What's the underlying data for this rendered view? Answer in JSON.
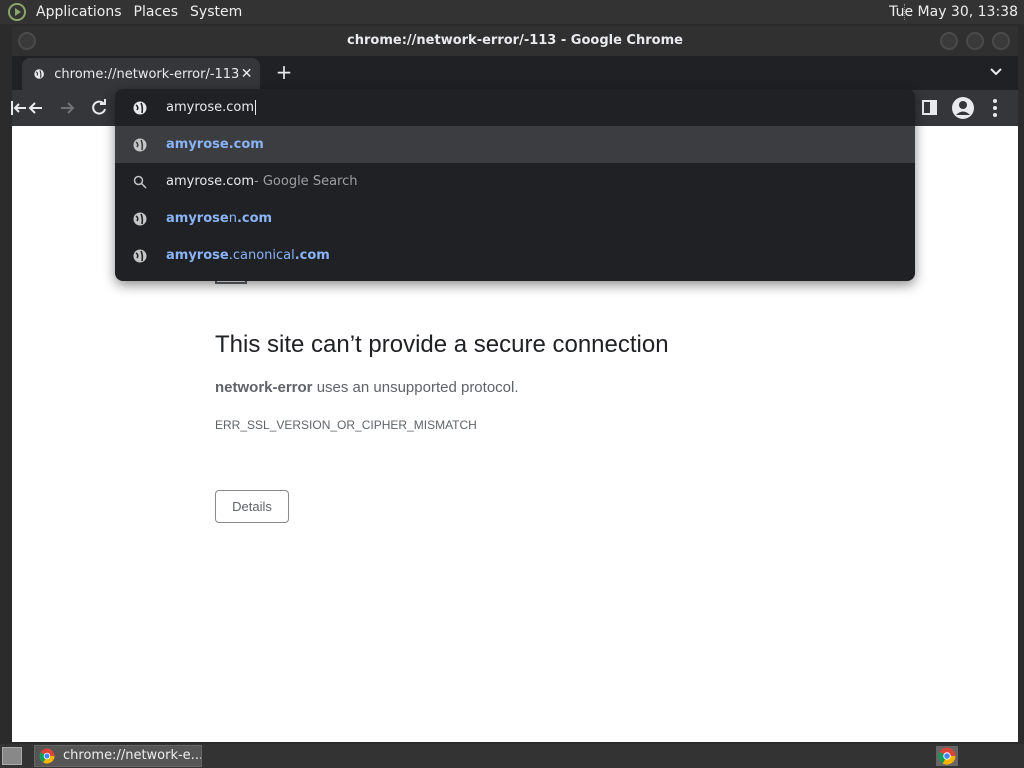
{
  "top_panel": {
    "menus": [
      "Applications",
      "Places",
      "System"
    ],
    "clock": "Tue May 30, 13:38"
  },
  "window": {
    "title": "chrome://network-error/-113 - Google Chrome",
    "tab": {
      "title": "chrome://network-error/-113",
      "close": "✕"
    },
    "new_tab": "+"
  },
  "omnibox": {
    "input_value": "amyrose.com",
    "suggestions": [
      {
        "type": "url",
        "icon": "globe-icon",
        "bold": "amyrose.com",
        "rest": "",
        "suffix": ""
      },
      {
        "type": "search",
        "icon": "search-icon",
        "text": "amyrose.com",
        "suffix": " - Google Search"
      },
      {
        "type": "url",
        "icon": "globe-icon",
        "bold": "amyrose",
        "mid": "n",
        "end": ".com"
      },
      {
        "type": "url",
        "icon": "globe-icon",
        "bold": "amyrose",
        "mid": ".canonical",
        "end": ".com"
      }
    ]
  },
  "error_page": {
    "title": "This site can’t provide a secure connection",
    "host": "network-error",
    "desc_rest": " uses an unsupported protocol.",
    "code": "ERR_SSL_VERSION_OR_CIPHER_MISMATCH",
    "details_button": "Details"
  },
  "taskbar": {
    "task_label": "chrome://network-e..."
  },
  "colors": {
    "accent": "#8ab4f8",
    "chrome_dark": "#202124",
    "toolbar": "#35363a"
  }
}
